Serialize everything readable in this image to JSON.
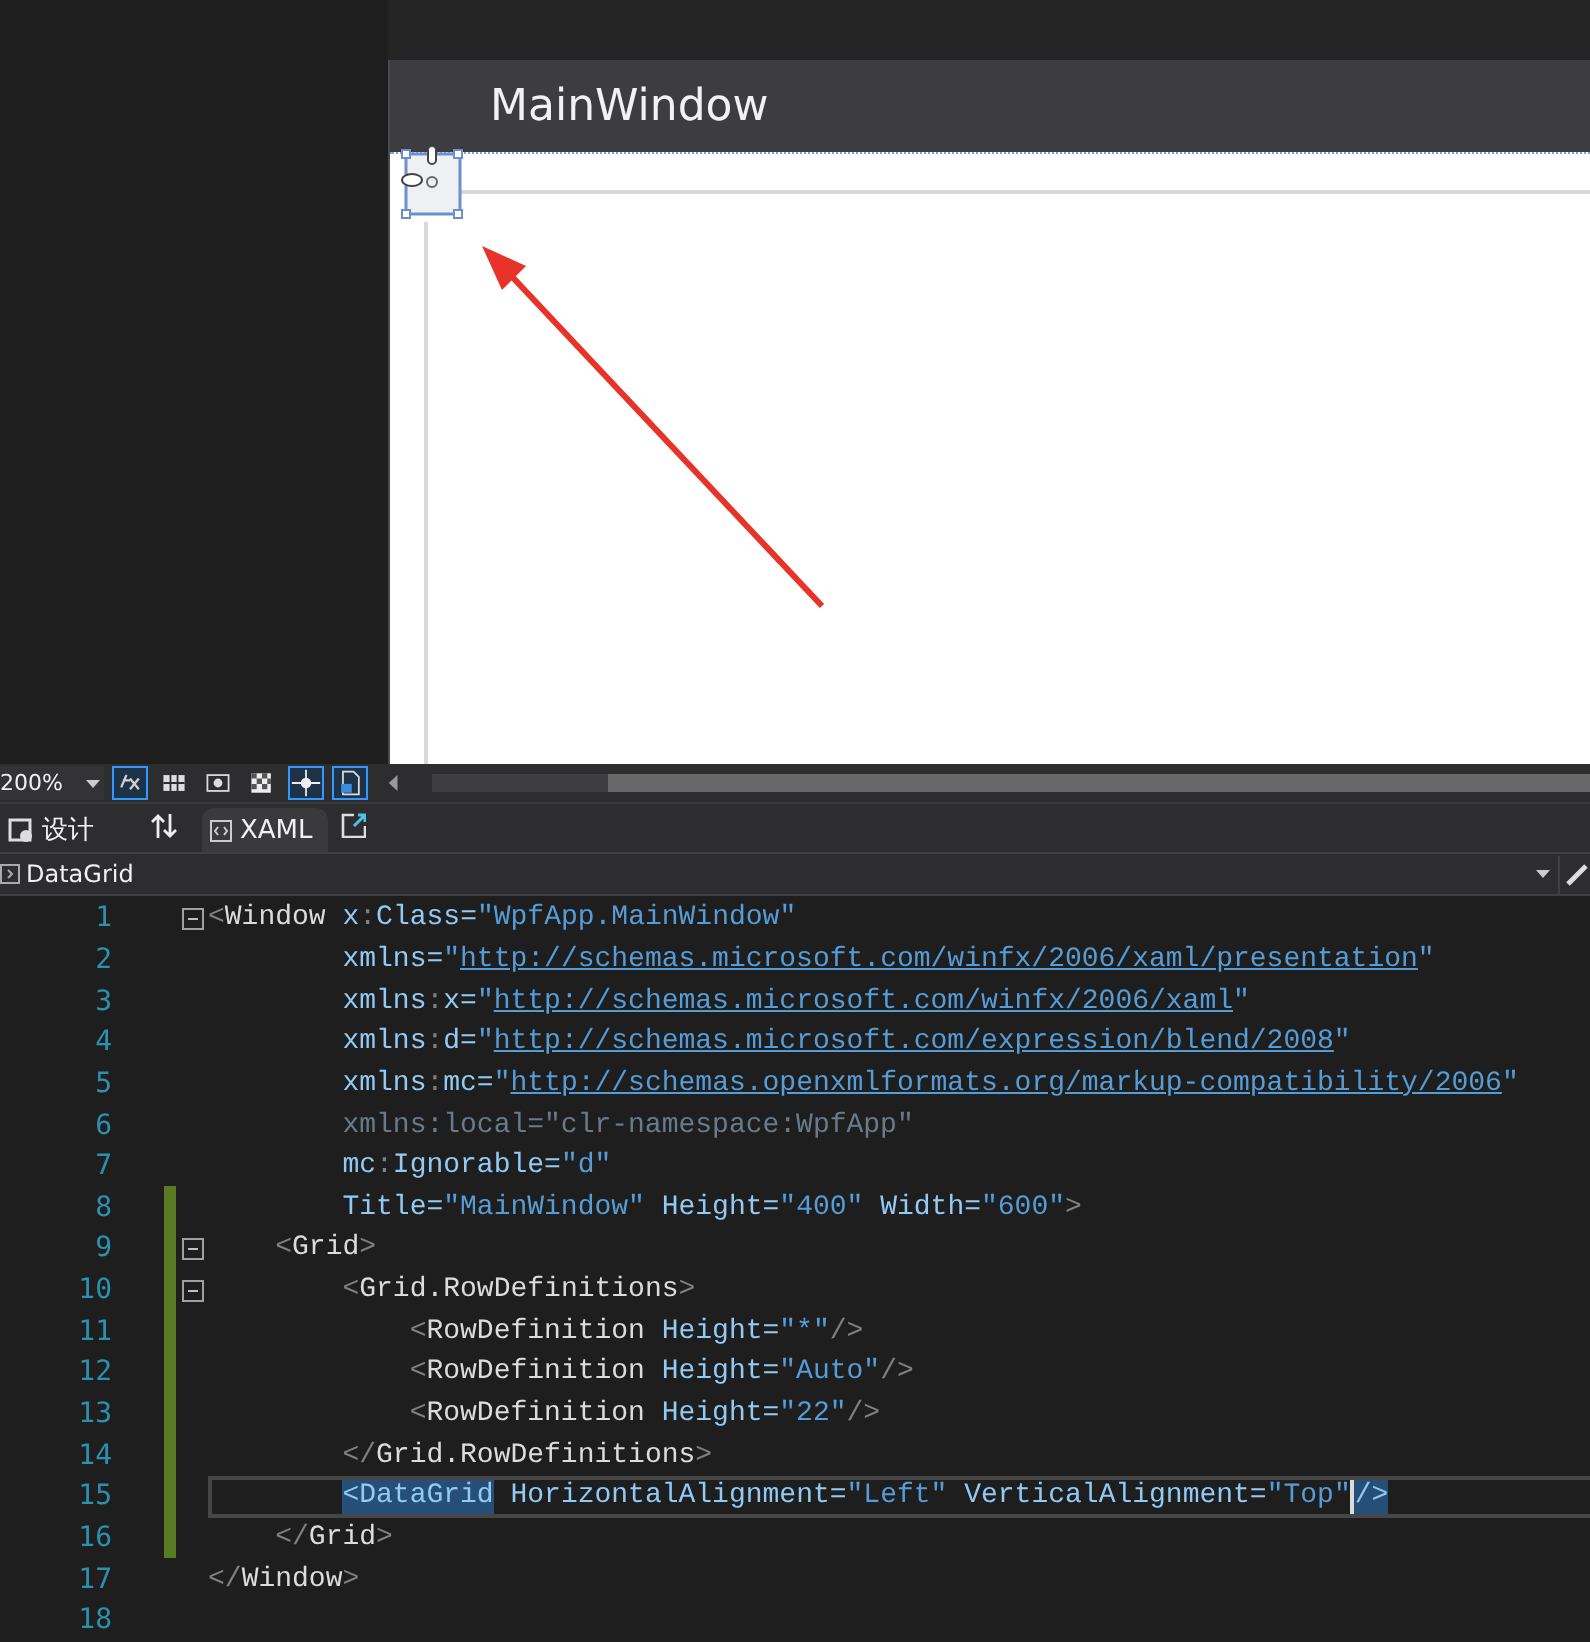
{
  "designer": {
    "window_title": "MainWindow"
  },
  "toolbar": {
    "zoom": "200%"
  },
  "tabs": [
    {
      "label": "设计",
      "selected": false
    },
    {
      "label": "XAML",
      "selected": true
    }
  ],
  "navbar": {
    "element": "DataGrid"
  },
  "editor": {
    "lines": [
      {
        "number": "1",
        "changed": false,
        "fold": true,
        "current": false,
        "tokens": [
          {
            "kind": "p",
            "text": "<"
          },
          {
            "kind": "e",
            "text": "Window"
          },
          {
            "kind": "a",
            "text": " x"
          },
          {
            "kind": "p",
            "text": ":"
          },
          {
            "kind": "a",
            "text": "Class"
          },
          {
            "kind": "a",
            "text": "="
          },
          {
            "kind": "s",
            "text": "\"WpfApp.MainWindow\""
          }
        ]
      },
      {
        "number": "2",
        "changed": false,
        "fold": false,
        "current": false,
        "tokens": [
          {
            "kind": "a",
            "text": "        xmlns="
          },
          {
            "kind": "s",
            "text": "\""
          },
          {
            "kind": "u",
            "text": "http://schemas.microsoft.com/winfx/2006/xaml/presentation"
          },
          {
            "kind": "s",
            "text": "\""
          }
        ]
      },
      {
        "number": "3",
        "changed": false,
        "fold": false,
        "current": false,
        "tokens": [
          {
            "kind": "a",
            "text": "        xmlns"
          },
          {
            "kind": "p",
            "text": ":"
          },
          {
            "kind": "a",
            "text": "x="
          },
          {
            "kind": "s",
            "text": "\""
          },
          {
            "kind": "u",
            "text": "http://schemas.microsoft.com/winfx/2006/xaml"
          },
          {
            "kind": "s",
            "text": "\""
          }
        ]
      },
      {
        "number": "4",
        "changed": false,
        "fold": false,
        "current": false,
        "tokens": [
          {
            "kind": "a",
            "text": "        xmlns"
          },
          {
            "kind": "p",
            "text": ":"
          },
          {
            "kind": "a",
            "text": "d="
          },
          {
            "kind": "s",
            "text": "\""
          },
          {
            "kind": "u",
            "text": "http://schemas.microsoft.com/expression/blend/2008"
          },
          {
            "kind": "s",
            "text": "\""
          }
        ]
      },
      {
        "number": "5",
        "changed": false,
        "fold": false,
        "current": false,
        "tokens": [
          {
            "kind": "a",
            "text": "        xmlns"
          },
          {
            "kind": "p",
            "text": ":"
          },
          {
            "kind": "a",
            "text": "mc="
          },
          {
            "kind": "s",
            "text": "\""
          },
          {
            "kind": "u",
            "text": "http://schemas.openxmlformats.org/markup-compatibility/2006"
          },
          {
            "kind": "s",
            "text": "\""
          }
        ]
      },
      {
        "number": "6",
        "changed": false,
        "fold": false,
        "current": false,
        "tokens": [
          {
            "kind": "dim",
            "text": "        xmlns:local=\"clr-namespace:WpfApp\""
          }
        ]
      },
      {
        "number": "7",
        "changed": false,
        "fold": false,
        "current": false,
        "tokens": [
          {
            "kind": "a",
            "text": "        mc"
          },
          {
            "kind": "p",
            "text": ":"
          },
          {
            "kind": "a",
            "text": "Ignorable="
          },
          {
            "kind": "s",
            "text": "\"d\""
          }
        ]
      },
      {
        "number": "8",
        "changed": true,
        "fold": false,
        "current": false,
        "tokens": [
          {
            "kind": "a",
            "text": "        Title="
          },
          {
            "kind": "s",
            "text": "\"MainWindow\""
          },
          {
            "kind": "a",
            "text": " Height="
          },
          {
            "kind": "s",
            "text": "\"400\""
          },
          {
            "kind": "a",
            "text": " Width="
          },
          {
            "kind": "s",
            "text": "\"600\""
          },
          {
            "kind": "p",
            "text": ">"
          }
        ]
      },
      {
        "number": "9",
        "changed": true,
        "fold": true,
        "current": false,
        "tokens": [
          {
            "kind": "p",
            "text": "    <"
          },
          {
            "kind": "e",
            "text": "Grid"
          },
          {
            "kind": "p",
            "text": ">"
          }
        ]
      },
      {
        "number": "10",
        "changed": true,
        "fold": true,
        "current": false,
        "tokens": [
          {
            "kind": "p",
            "text": "        <"
          },
          {
            "kind": "e",
            "text": "Grid.RowDefinitions"
          },
          {
            "kind": "p",
            "text": ">"
          }
        ]
      },
      {
        "number": "11",
        "changed": true,
        "fold": false,
        "current": false,
        "tokens": [
          {
            "kind": "p",
            "text": "            <"
          },
          {
            "kind": "e",
            "text": "RowDefinition"
          },
          {
            "kind": "a",
            "text": " Height="
          },
          {
            "kind": "s",
            "text": "\"*\""
          },
          {
            "kind": "p",
            "text": "/>"
          }
        ]
      },
      {
        "number": "12",
        "changed": true,
        "fold": false,
        "current": false,
        "tokens": [
          {
            "kind": "p",
            "text": "            <"
          },
          {
            "kind": "e",
            "text": "RowDefinition"
          },
          {
            "kind": "a",
            "text": " Height="
          },
          {
            "kind": "s",
            "text": "\"Auto\""
          },
          {
            "kind": "p",
            "text": "/>"
          }
        ]
      },
      {
        "number": "13",
        "changed": true,
        "fold": false,
        "current": false,
        "tokens": [
          {
            "kind": "p",
            "text": "            <"
          },
          {
            "kind": "e",
            "text": "RowDefinition"
          },
          {
            "kind": "a",
            "text": " Height="
          },
          {
            "kind": "s",
            "text": "\"22\""
          },
          {
            "kind": "p",
            "text": "/>"
          }
        ]
      },
      {
        "number": "14",
        "changed": true,
        "fold": false,
        "current": false,
        "tokens": [
          {
            "kind": "p",
            "text": "        </"
          },
          {
            "kind": "e",
            "text": "Grid.RowDefinitions"
          },
          {
            "kind": "p",
            "text": ">"
          }
        ]
      },
      {
        "number": "15",
        "changed": true,
        "fold": false,
        "current": true,
        "tokens": [
          {
            "kind": "hl",
            "text": "        <DataGrid"
          },
          {
            "kind": "a",
            "text": " HorizontalAlignment="
          },
          {
            "kind": "s",
            "text": "\"Left\""
          },
          {
            "kind": "a",
            "text": " VerticalAlignment="
          },
          {
            "kind": "s",
            "text": "\"Top\""
          },
          {
            "kind": "hl",
            "text": "/>"
          }
        ]
      },
      {
        "number": "16",
        "changed": true,
        "fold": false,
        "current": false,
        "tokens": [
          {
            "kind": "p",
            "text": "    </"
          },
          {
            "kind": "e",
            "text": "Grid"
          },
          {
            "kind": "p",
            "text": ">"
          }
        ]
      },
      {
        "number": "17",
        "changed": false,
        "fold": false,
        "current": false,
        "tokens": [
          {
            "kind": "p",
            "text": "</"
          },
          {
            "kind": "e",
            "text": "Window"
          },
          {
            "kind": "p",
            "text": ">"
          }
        ]
      },
      {
        "number": "18",
        "changed": false,
        "fold": false,
        "current": false
      }
    ]
  }
}
